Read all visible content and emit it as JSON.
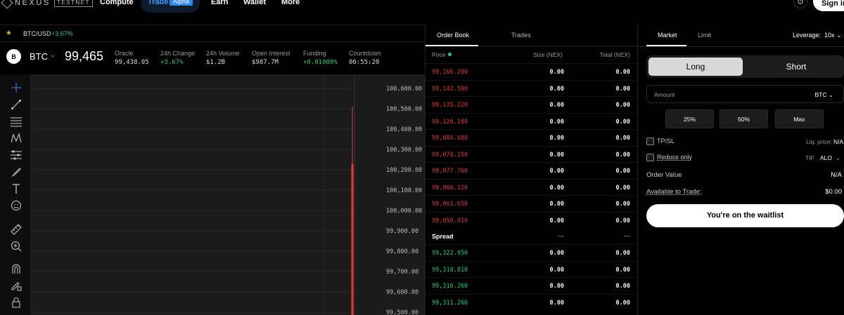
{
  "nav": {
    "logo": "NEXUS",
    "logo_badge": "TESTNET",
    "items": [
      "Compute",
      "Trade",
      "Earn",
      "Wallet",
      "More"
    ],
    "trade_badge": "Alpha",
    "signin": "Sign in"
  },
  "ticker": {
    "pair": "BTC/USD",
    "change": "+3.67%"
  },
  "market": {
    "coin_letter": "B",
    "coin": "BTC",
    "price": "99,465",
    "stats": [
      {
        "label": "Oracle",
        "value": "99,438.05"
      },
      {
        "label": "24h Change",
        "value": "+3.67%"
      },
      {
        "label": "24h Volume",
        "value": "$1.2B"
      },
      {
        "label": "Open Interest",
        "value": "$987.7M"
      },
      {
        "label": "Funding",
        "value": "+0.01000%"
      },
      {
        "label": "Countdown",
        "value": "06:55:20"
      }
    ]
  },
  "toolbar": {
    "icons": [
      "crosshair-icon",
      "trend-line-icon",
      "fib-retracement-icon",
      "pattern-icon",
      "prediction-icon",
      "brush-icon",
      "text-icon",
      "emoji-icon",
      "ruler-icon",
      "zoom-in-icon",
      "magnet-icon",
      "lock-drawing-icon",
      "lock-icon"
    ]
  },
  "chart": {
    "price_axis": [
      "100,600.00",
      "100,500.00",
      "100,400.00",
      "100,300.00",
      "100,200.00",
      "100,100.00",
      "100,000.00",
      "99,900.00",
      "99,800.00",
      "99,700.00",
      "99,600.00",
      "99,500.00"
    ],
    "candle": {
      "high": 100510,
      "open": 100230,
      "close": 99470,
      "color": "#e53935"
    }
  },
  "orderbook": {
    "tabs": [
      "Order Book",
      "Trades"
    ],
    "headers": {
      "price": "Price",
      "size": "Size (NEX)",
      "total": "Total (NEX)"
    },
    "asks": [
      {
        "price": "99,166.290",
        "size": "0.00",
        "total": "0.00"
      },
      {
        "price": "99,142.590",
        "size": "0.00",
        "total": "0.00"
      },
      {
        "price": "99,135.220",
        "size": "0.00",
        "total": "0.00"
      },
      {
        "price": "99,126.180",
        "size": "0.00",
        "total": "0.00"
      },
      {
        "price": "99,084.680",
        "size": "0.00",
        "total": "0.00"
      },
      {
        "price": "99,078.250",
        "size": "0.00",
        "total": "0.00"
      },
      {
        "price": "99,077.760",
        "size": "0.00",
        "total": "0.00"
      },
      {
        "price": "99,066.120",
        "size": "0.00",
        "total": "0.00"
      },
      {
        "price": "99,061.650",
        "size": "0.00",
        "total": "0.00"
      },
      {
        "price": "99,059.910",
        "size": "0.00",
        "total": "0.00"
      }
    ],
    "spread": {
      "label": "Spread",
      "size": "—",
      "total": "—"
    },
    "bids": [
      {
        "price": "99,322.050",
        "size": "0.00",
        "total": "0.00"
      },
      {
        "price": "99,318.810",
        "size": "0.00",
        "total": "0.00"
      },
      {
        "price": "99,316.260",
        "size": "0.00",
        "total": "0.00"
      },
      {
        "price": "99,311.260",
        "size": "0.00",
        "total": "0.00"
      }
    ]
  },
  "order": {
    "tabs": [
      "Market",
      "Limit"
    ],
    "leverage_label": "Leverage:",
    "leverage_value": "10x",
    "long": "Long",
    "short": "Short",
    "amount_label": "Amount",
    "amount_unit": "BTC",
    "percents": [
      "25%",
      "50%",
      "Max"
    ],
    "tpsl": "TP/SL",
    "liq_label": "Liq. price:",
    "liq_value": "N/A",
    "reduce_only": "Reduce only",
    "tif_label": "TIF",
    "tif_value": "ALO",
    "order_value_label": "Order Value",
    "order_value": "N/A",
    "available_label": "Available to Trade:",
    "available_value": "$0.00",
    "waitlist": "You're on the waitlist"
  }
}
